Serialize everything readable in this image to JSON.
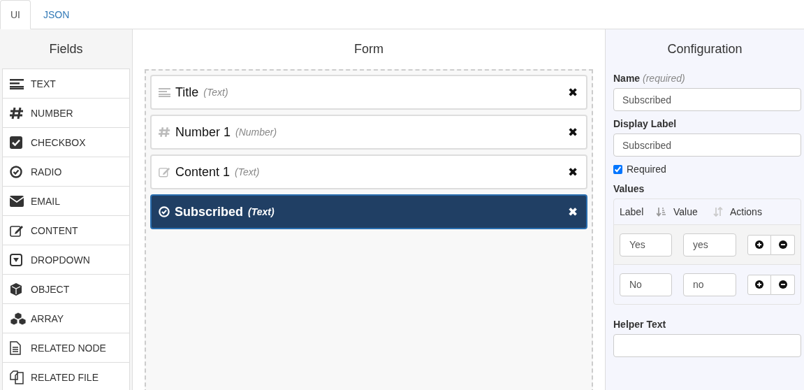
{
  "tabs": [
    {
      "label": "UI",
      "selected": true
    },
    {
      "label": "JSON",
      "selected": false
    }
  ],
  "fields_panel": {
    "title": "Fields",
    "items": [
      {
        "label": "TEXT",
        "kind": "text"
      },
      {
        "label": "NUMBER",
        "kind": "number"
      },
      {
        "label": "CHECKBOX",
        "kind": "checkbox"
      },
      {
        "label": "RADIO",
        "kind": "radio"
      },
      {
        "label": "EMAIL",
        "kind": "email"
      },
      {
        "label": "CONTENT",
        "kind": "content"
      },
      {
        "label": "DROPDOWN",
        "kind": "dropdown"
      },
      {
        "label": "OBJECT",
        "kind": "object"
      },
      {
        "label": "ARRAY",
        "kind": "array"
      },
      {
        "label": "RELATED NODE",
        "kind": "node"
      },
      {
        "label": "RELATED FILE",
        "kind": "file"
      }
    ]
  },
  "form_panel": {
    "title": "Form",
    "items": [
      {
        "label": "Title",
        "type": "(Text)",
        "kind": "text",
        "selected": false,
        "remove": "✖"
      },
      {
        "label": "Number 1",
        "type": "(Number)",
        "kind": "number",
        "selected": false,
        "remove": "✖"
      },
      {
        "label": "Content 1",
        "type": "(Text)",
        "kind": "content",
        "selected": false,
        "remove": "✖"
      },
      {
        "label": "Subscribed",
        "type": "(Text)",
        "kind": "radio",
        "selected": true,
        "remove": "✖"
      }
    ]
  },
  "config_panel": {
    "title": "Configuration",
    "name": {
      "label": "Name",
      "hint": "(required)",
      "value": "Subscribed"
    },
    "display_label": {
      "label": "Display Label",
      "value": "Subscribed"
    },
    "required": {
      "label": "Required",
      "checked": true
    },
    "values": {
      "label": "Values",
      "columns": [
        "Label",
        "Value",
        "Actions"
      ],
      "rows": [
        {
          "label": "Yes",
          "value": "yes"
        },
        {
          "label": "No",
          "value": "no"
        }
      ]
    },
    "helper_text": {
      "label": "Helper Text"
    }
  }
}
